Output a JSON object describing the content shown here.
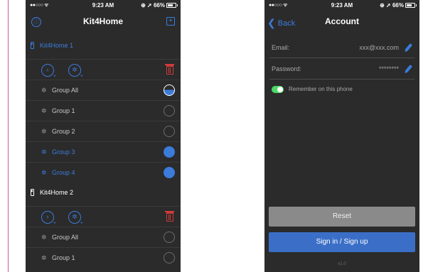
{
  "left_screen": {
    "status": {
      "signal": "●●○○○ ᯤ",
      "time": "9:23 AM",
      "battery": "⊕ ➚ 66%"
    },
    "nav": {
      "title": "Kit4Home",
      "left_icon": "user-circle-icon",
      "right_icon": "add-box-icon",
      "right_glyph": "+"
    },
    "devices": [
      {
        "label": "Kit4Home 1",
        "color": "#3b7cdb",
        "groups": [
          {
            "label": "Group All",
            "state": "partial"
          },
          {
            "label": "Group 1",
            "state": "off"
          },
          {
            "label": "Group 2",
            "state": "off"
          },
          {
            "label": "Group 3",
            "state": "on"
          },
          {
            "label": "Group 4",
            "state": "on"
          }
        ]
      },
      {
        "label": "Kit4Home 2",
        "color": "#ffffff",
        "groups": [
          {
            "label": "Group All",
            "state": "off"
          },
          {
            "label": "Group 1",
            "state": "off"
          }
        ]
      }
    ],
    "icons": {
      "group": "✲",
      "bulb": "♁",
      "group_add": "✲",
      "plus": "+"
    }
  },
  "right_screen": {
    "status": {
      "signal": "●●○○○ ᯤ",
      "time": "9:23 AM",
      "battery": "⊕ ➚ 66%"
    },
    "nav": {
      "back_chevron": "❮",
      "back_label": "Back",
      "title": "Account"
    },
    "fields": [
      {
        "label": "Email:",
        "value": "xxx@xxx.com"
      },
      {
        "label": "Password:",
        "value": "********"
      }
    ],
    "remember": {
      "label": "Remember on this phone",
      "on": true
    },
    "buttons": {
      "reset": "Reset",
      "sign_in": "Sign in / Sign up"
    },
    "version": "v1.0"
  },
  "colors": {
    "accent": "#3b7cdb",
    "danger": "#d03a3a",
    "toggle_on": "#4cd964",
    "background": "#2b2b2b"
  }
}
